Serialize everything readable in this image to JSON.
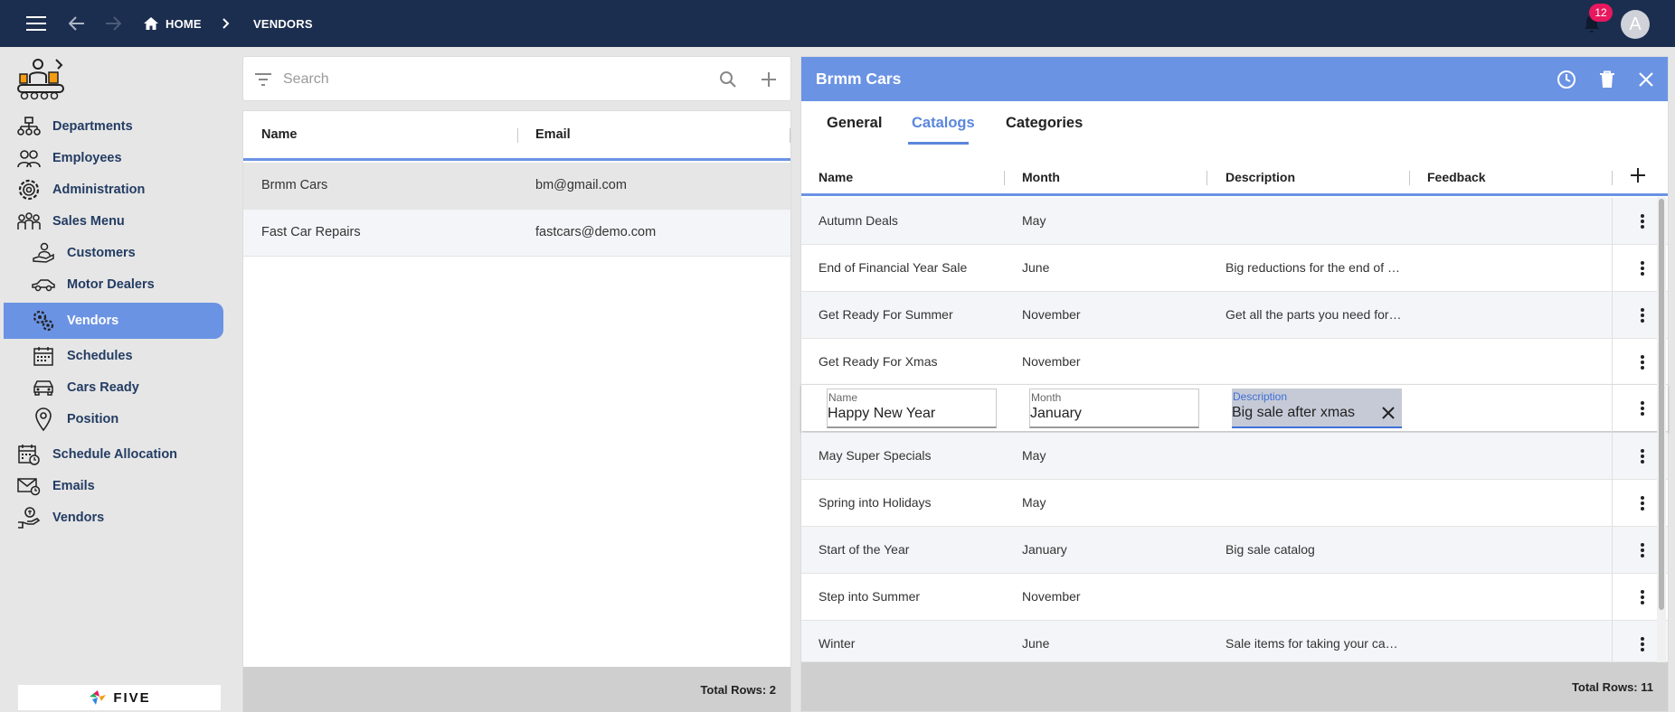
{
  "topbar": {
    "breadcrumbs": [
      "HOME",
      "VENDORS"
    ],
    "notification_count": "12",
    "avatar_initial": "A"
  },
  "sidebar": {
    "items": [
      {
        "label": "Departments",
        "icon": "departments-icon"
      },
      {
        "label": "Employees",
        "icon": "employees-icon"
      },
      {
        "label": "Administration",
        "icon": "administration-icon"
      },
      {
        "label": "Sales Menu",
        "icon": "sales-menu-icon"
      },
      {
        "label": "Customers",
        "icon": "customers-icon"
      },
      {
        "label": "Motor Dealers",
        "icon": "motor-dealers-icon"
      },
      {
        "label": "Vendors",
        "icon": "vendors-icon",
        "active": true
      },
      {
        "label": "Schedules",
        "icon": "schedules-icon"
      },
      {
        "label": "Cars Ready",
        "icon": "cars-ready-icon"
      },
      {
        "label": "Position",
        "icon": "position-icon"
      },
      {
        "label": "Schedule Allocation",
        "icon": "schedule-allocation-icon"
      },
      {
        "label": "Emails",
        "icon": "emails-icon"
      },
      {
        "label": "Vendors",
        "icon": "vendors-hand-icon"
      }
    ],
    "footer_logo": "FIVE"
  },
  "list": {
    "search_placeholder": "Search",
    "columns": [
      "Name",
      "Email"
    ],
    "rows": [
      {
        "name": "Brmm Cars",
        "email": "bm@gmail.com"
      },
      {
        "name": "Fast Car Repairs",
        "email": "fastcars@demo.com"
      }
    ],
    "total_rows": "Total Rows: 2"
  },
  "detail": {
    "title": "Brmm Cars",
    "tabs": [
      "General",
      "Catalogs",
      "Categories"
    ],
    "active_tab": "Catalogs",
    "columns": [
      "Name",
      "Month",
      "Description",
      "Feedback"
    ],
    "rows": [
      {
        "name": "Autumn Deals",
        "month": "May",
        "description": ""
      },
      {
        "name": "End of Financial Year Sale",
        "month": "June",
        "description": "Big reductions for the end of …"
      },
      {
        "name": "Get Ready For Summer",
        "month": "November",
        "description": "Get all the parts you need for…"
      },
      {
        "name": "Get Ready For Xmas",
        "month": "November",
        "description": ""
      },
      {
        "name": "May Super Specials",
        "month": "May",
        "description": ""
      },
      {
        "name": "Spring into Holidays",
        "month": "May",
        "description": ""
      },
      {
        "name": "Start of the Year",
        "month": "January",
        "description": "Big sale catalog"
      },
      {
        "name": "Step into Summer",
        "month": "November",
        "description": ""
      },
      {
        "name": "Winter",
        "month": "June",
        "description": "Sale items for taking your ca…"
      }
    ],
    "edit_row": {
      "name_label": "Name",
      "name_value": "Happy New Year",
      "month_label": "Month",
      "month_value": "January",
      "description_label": "Description",
      "description_value": "Big sale after xmas"
    },
    "total_rows": "Total Rows: 11"
  }
}
